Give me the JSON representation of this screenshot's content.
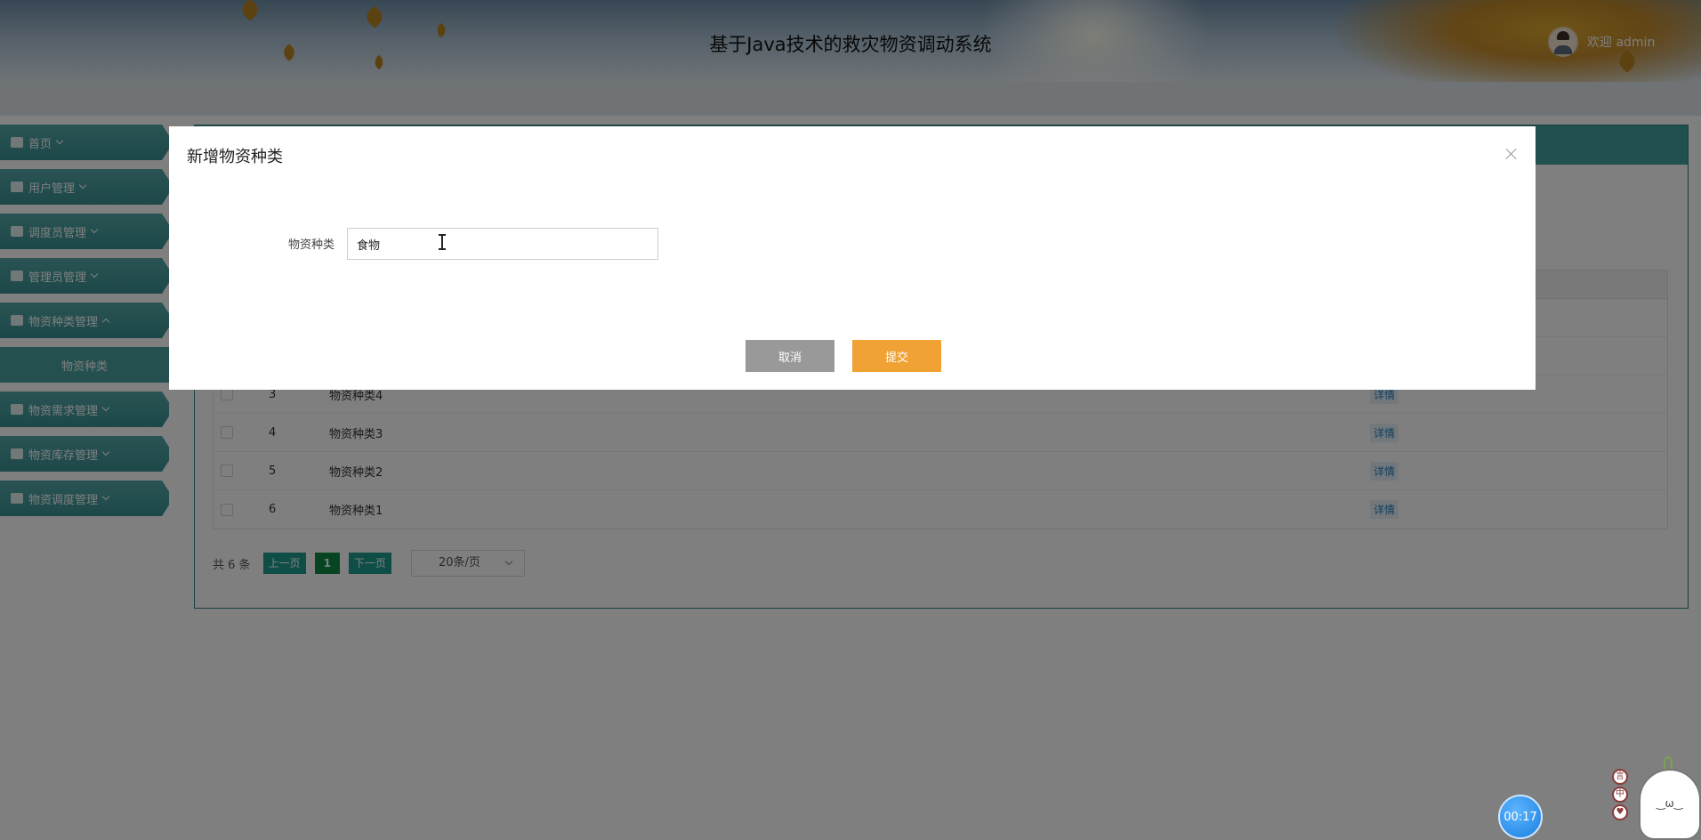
{
  "header": {
    "title": "基于Java技术的救灾物资调动系统",
    "welcome": "欢迎 admin"
  },
  "sidebar": {
    "items": [
      {
        "label": "首页",
        "icon": "home-icon"
      },
      {
        "label": "用户管理",
        "icon": "user-icon"
      },
      {
        "label": "调度员管理",
        "icon": "briefcase-icon"
      },
      {
        "label": "管理员管理",
        "icon": "card-icon"
      },
      {
        "label": "物资种类管理",
        "icon": "copy-icon",
        "expanded": true
      },
      {
        "label": "物资需求管理",
        "icon": "box-icon"
      },
      {
        "label": "物资库存管理",
        "icon": "folder-icon"
      },
      {
        "label": "物资调度管理",
        "icon": "person-icon"
      }
    ],
    "sub_item": "物资种类"
  },
  "table": {
    "rows": [
      {
        "id": "3",
        "name": "物资种类4",
        "op": "详情"
      },
      {
        "id": "4",
        "name": "物资种类3",
        "op": "详情"
      },
      {
        "id": "5",
        "name": "物资种类2",
        "op": "详情"
      },
      {
        "id": "6",
        "name": "物资种类1",
        "op": "详情"
      }
    ]
  },
  "pagination": {
    "total": "共 6 条",
    "prev": "上一页",
    "current": "1",
    "next": "下一页",
    "page_size": "20条/页"
  },
  "dialog": {
    "title": "新增物资种类",
    "field_label": "物资种类",
    "field_value": "食物",
    "cancel": "取消",
    "submit": "提交"
  },
  "widgets": {
    "timer": "00:17",
    "mini_icons": [
      "言",
      "中",
      "♥"
    ]
  },
  "colors": {
    "sidebar_teal": "#3a8f91",
    "submit_orange": "#f0a235",
    "cancel_gray": "#999999",
    "pager_green": "#1e9c8f"
  }
}
